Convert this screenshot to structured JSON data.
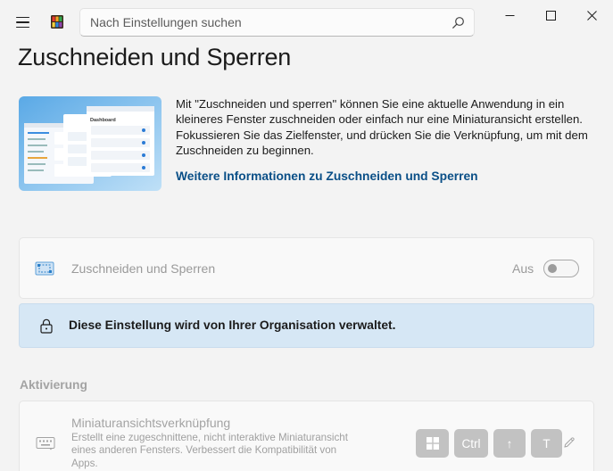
{
  "titlebar": {
    "search_placeholder": "Nach Einstellungen suchen",
    "icons": [
      "hamburger-menu-icon",
      "settings-app-logo",
      "search-icon",
      "minimize-icon",
      "maximize-icon",
      "close-icon"
    ]
  },
  "page": {
    "title": "Zuschneiden und Sperren",
    "description": "Mit \"Zuschneiden und sperren\" können Sie eine aktuelle Anwendung in ein kleineres Fenster zuschneiden oder einfach nur eine Miniaturansicht erstellen. Fokussieren Sie das Zielfenster, und drücken Sie die Verknüpfung, um mit dem Zuschneiden zu beginnen.",
    "link": "Weitere Informationen zu Zuschneiden und Sperren",
    "hero_mock_title": "Dashboard"
  },
  "toggle_card": {
    "label": "Zuschneiden und Sperren",
    "state_label": "Aus",
    "enabled": false,
    "disabled": true
  },
  "info_bar": {
    "message": "Diese Einstellung wird von Ihrer Organisation verwaltet."
  },
  "activation": {
    "section_title": "Aktivierung",
    "shortcut": {
      "title": "Miniaturansichtsverknüpfung",
      "description": "Erstellt eine zugeschnittene, nicht interaktive Miniaturansicht eines anderen Fensters. Verbessert die Kompatibilität von Apps.",
      "keys": {
        "win": "windows-key-icon",
        "ctrl": "Ctrl",
        "arrow": "↑",
        "letter": "T"
      }
    }
  },
  "colors": {
    "background": "#f3f3f3",
    "accent_link": "#0a4f87",
    "info_bar": "#d6e7f5",
    "key_disabled": "#c2c2c2"
  }
}
